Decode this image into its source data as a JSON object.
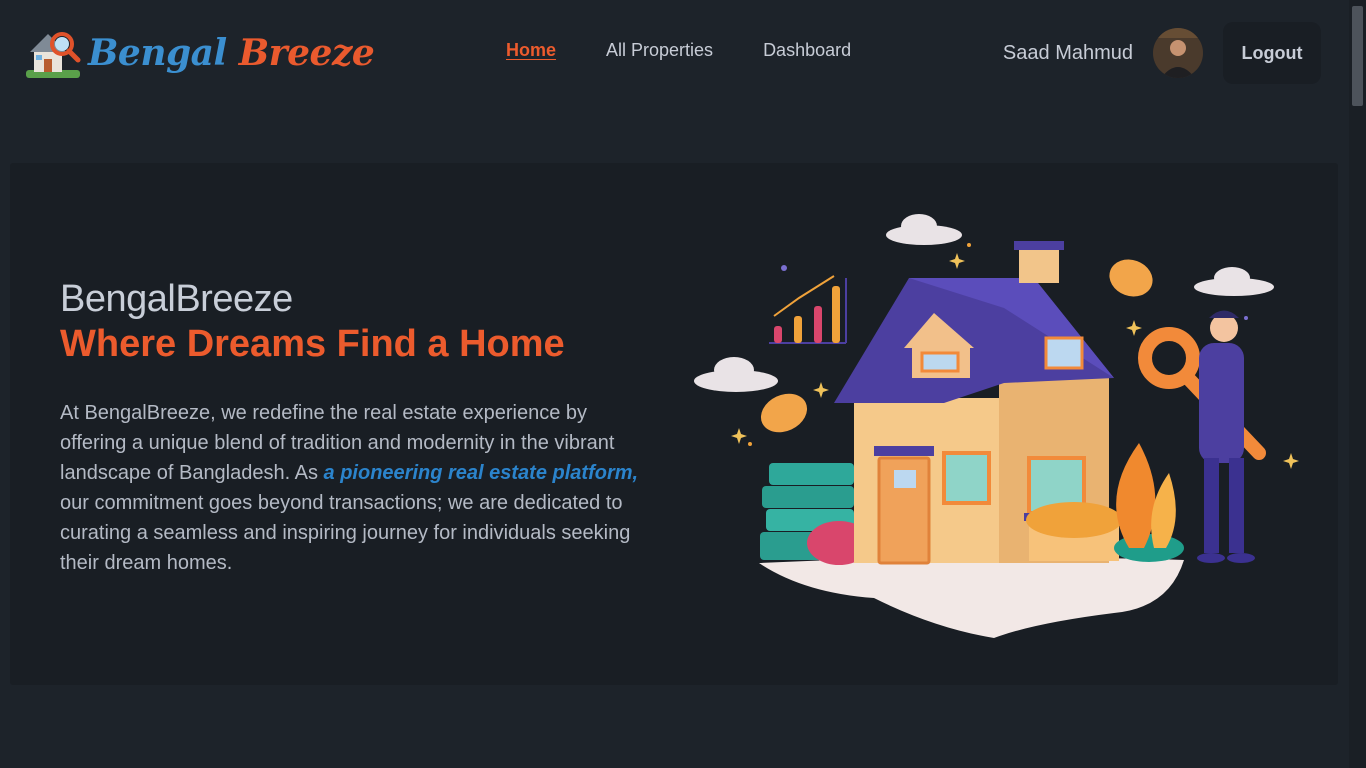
{
  "brand": {
    "name_part1": "Bengal",
    "name_part2": "Breeze",
    "logo_icon": "house-magnifier-icon"
  },
  "nav": {
    "links": [
      {
        "label": "Home",
        "active": true
      },
      {
        "label": "All Properties",
        "active": false
      },
      {
        "label": "Dashboard",
        "active": false
      }
    ]
  },
  "user": {
    "name": "Saad Mahmud",
    "logout_label": "Logout"
  },
  "hero": {
    "brand": "BengalBreeze",
    "tagline": "Where Dreams Find a Home",
    "desc_before": "At BengalBreeze, we redefine the real estate experience by offering a unique blend of tradition and modernity in the vibrant landscape of Bangladesh. As ",
    "desc_highlight": "a pioneering real estate platform,",
    "desc_after": " our commitment goes beyond transactions; we are dedicated to curating a seamless and inspiring journey for individuals seeking their dream homes."
  },
  "colors": {
    "accent": "#ec5b2d",
    "link_blue": "#2b84cc",
    "background": "#1d232a",
    "card": "#191e24"
  }
}
